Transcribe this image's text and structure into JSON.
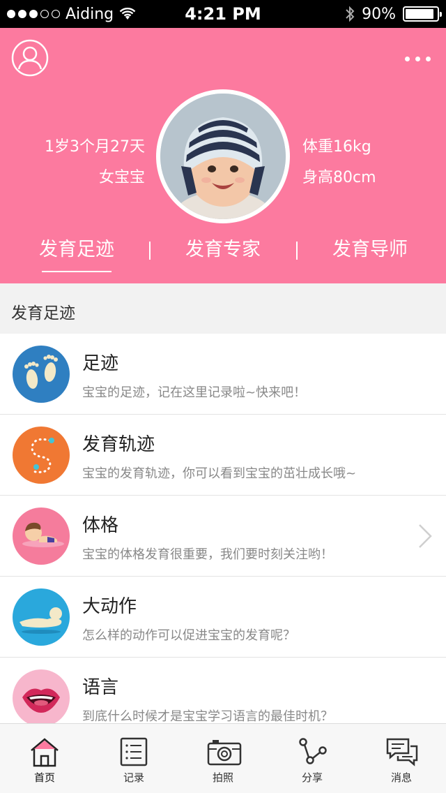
{
  "status_bar": {
    "carrier": "Aiding",
    "time": "4:21 PM",
    "battery": "90%",
    "battery_level": 0.9,
    "signal_bars_filled": 3,
    "signal_bars_total": 5
  },
  "header": {
    "age": "1岁3个月27天",
    "gender": "女宝宝",
    "weight": "体重16kg",
    "height": "身高80cm",
    "tabs": [
      {
        "label": "发育足迹",
        "active": true
      },
      {
        "label": "发育专家",
        "active": false
      },
      {
        "label": "发育导师",
        "active": false
      }
    ]
  },
  "section": {
    "title": "发育足迹"
  },
  "items": [
    {
      "title": "足迹",
      "desc": "宝宝的足迹，记在这里记录啦~快来吧！",
      "icon": "footprints-icon",
      "color": "#2f7fc1"
    },
    {
      "title": "发育轨迹",
      "desc": "宝宝的发育轨迹，你可以看到宝宝的茁壮成长哦~",
      "icon": "growth-track-icon",
      "color": "#f07833"
    },
    {
      "title": "体格",
      "desc": "宝宝的体格发育很重要，我们要时刻关注哟！",
      "icon": "baby-crawling-icon",
      "color": "#f57c9c"
    },
    {
      "title": "大动作",
      "desc": "怎么样的动作可以促进宝宝的发育呢？",
      "icon": "baby-lying-icon",
      "color": "#2aa8dc"
    },
    {
      "title": "语言",
      "desc": "到底什么时候才是宝宝学习语言的最佳时机？",
      "icon": "lips-icon",
      "color": "#f7b6cc"
    }
  ],
  "tabbar": [
    {
      "label": "首页",
      "icon": "home-icon",
      "active": true
    },
    {
      "label": "记录",
      "icon": "list-icon",
      "active": false
    },
    {
      "label": "拍照",
      "icon": "camera-icon",
      "active": false
    },
    {
      "label": "分享",
      "icon": "share-icon",
      "active": false
    },
    {
      "label": "消息",
      "icon": "message-icon",
      "active": false
    }
  ],
  "colors": {
    "header_pink": "#fc7a9f",
    "background": "#f2f2f2"
  }
}
